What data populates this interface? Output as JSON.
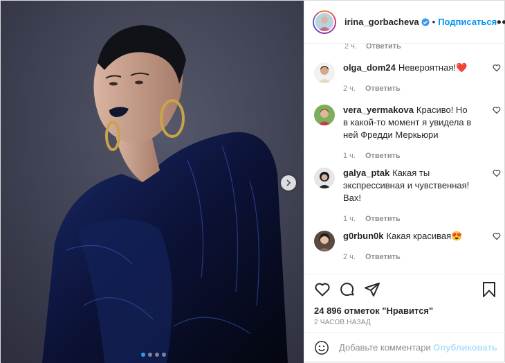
{
  "post": {
    "author": "irina_gorbacheva",
    "separator": "•",
    "follow_label": "Подписаться",
    "more_label": "•••"
  },
  "carousel": {
    "current_slide": 1,
    "total_slides": 4
  },
  "prev_comment_meta": {
    "time": "2 ч.",
    "reply_label": "Ответить"
  },
  "comments": [
    {
      "user": "olga_dom24",
      "text": "Невероятная!",
      "emoji": "❤️",
      "time": "2 ч.",
      "reply_label": "Ответить"
    },
    {
      "user": "vera_yermakova",
      "text": "Красиво! Но в какой-то момент я увидела в ней Фредди Меркьюри",
      "emoji": "",
      "time": "1 ч.",
      "reply_label": "Ответить"
    },
    {
      "user": "galya_ptak",
      "text": "Какая ты экспрессивная и чувственная! Вах!",
      "emoji": "",
      "time": "1 ч.",
      "reply_label": "Ответить"
    },
    {
      "user": "g0rbun0k",
      "text": "Какая красивая",
      "emoji": "😍",
      "time": "2 ч.",
      "reply_label": "Ответить"
    }
  ],
  "likes": {
    "text": "24 896 отметок \"Нравится\""
  },
  "timestamp": "2 ЧАСОВ НАЗАД",
  "add_comment": {
    "placeholder": "Добавьте комментарий...",
    "publish_label": "Опубликовать"
  },
  "colors": {
    "link_blue": "#0095f6",
    "verified_blue": "#3897f0",
    "muted": "#8e8e8e",
    "publish_disabled": "#b2dffc"
  }
}
